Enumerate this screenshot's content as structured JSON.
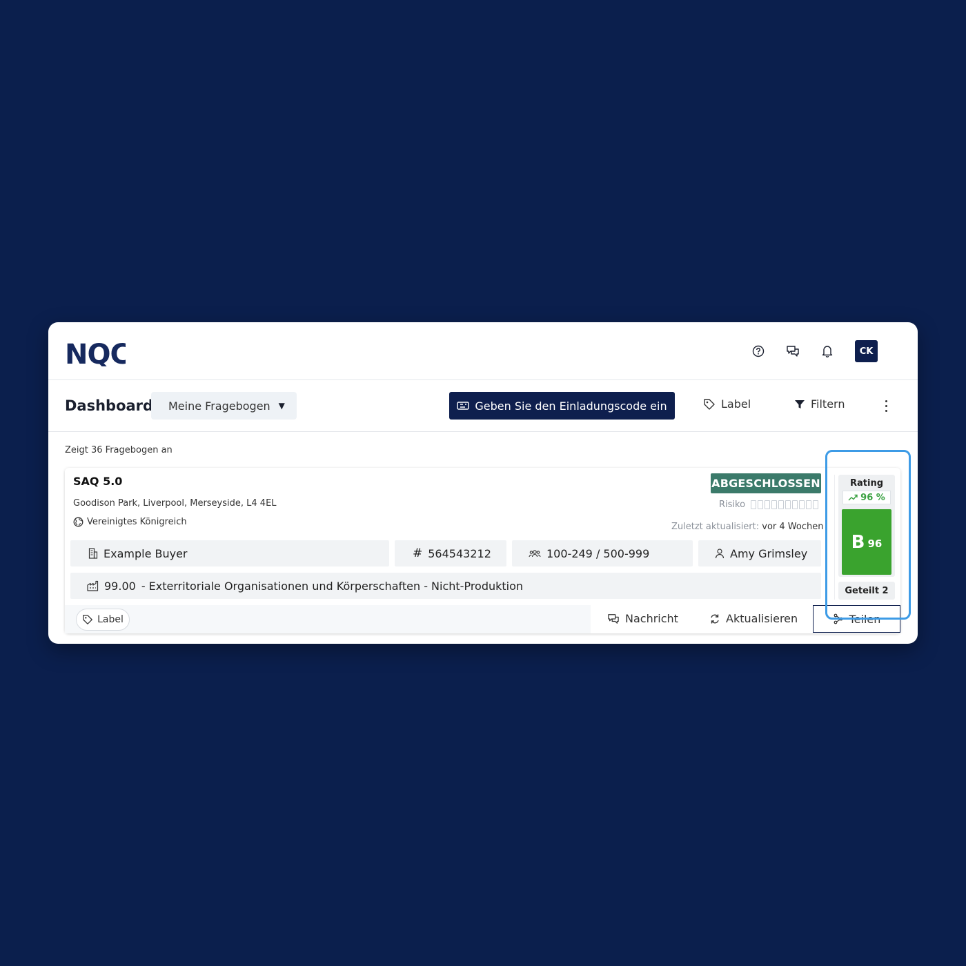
{
  "app": {
    "logo_text": "NQC",
    "avatar_initials": "CK"
  },
  "header_icons": [
    "help-circle-icon",
    "chat-icon",
    "bell-icon"
  ],
  "toolbar": {
    "title": "Dashboard",
    "view_select": "Meine Fragebogen",
    "invite_button": "Geben Sie den Einladungscode ein",
    "label_button": "Label",
    "filter_button": "Filtern"
  },
  "list": {
    "count_text": "Zeigt 36 Fragebogen an"
  },
  "card": {
    "title": "SAQ 5.0",
    "address": "Goodison Park, Liverpool, Merseyside, L4 4EL",
    "country": "Vereinigtes Königreich",
    "status": "ABGESCHLOSSEN",
    "risk_label": "Risiko",
    "risk_level": 0,
    "updated_label": "Zuletzt aktualisiert:",
    "updated_value": "vor 4 Wochen",
    "buyer": "Example Buyer",
    "id_number": "564543212",
    "employees": "100-249 / 500-999",
    "contact": "Amy Grimsley",
    "industry_code": "99.00",
    "industry_name": "- Exterritoriale Organisationen und Körperschaften - Nicht-Produktion",
    "tag_label": "Label",
    "message_button": "Nachricht",
    "refresh_button": "Aktualisieren",
    "share_button": "Teilen"
  },
  "rating": {
    "label": "Rating",
    "trend": "96 %",
    "grade": "B",
    "score": "96",
    "shared": "Geteilt 2"
  },
  "colors": {
    "background": "#0b1f4d",
    "primary": "#0e1f4e",
    "status_badge": "#3b7a6a",
    "grade_green": "#3aa32e",
    "highlight": "#3d9be6"
  }
}
